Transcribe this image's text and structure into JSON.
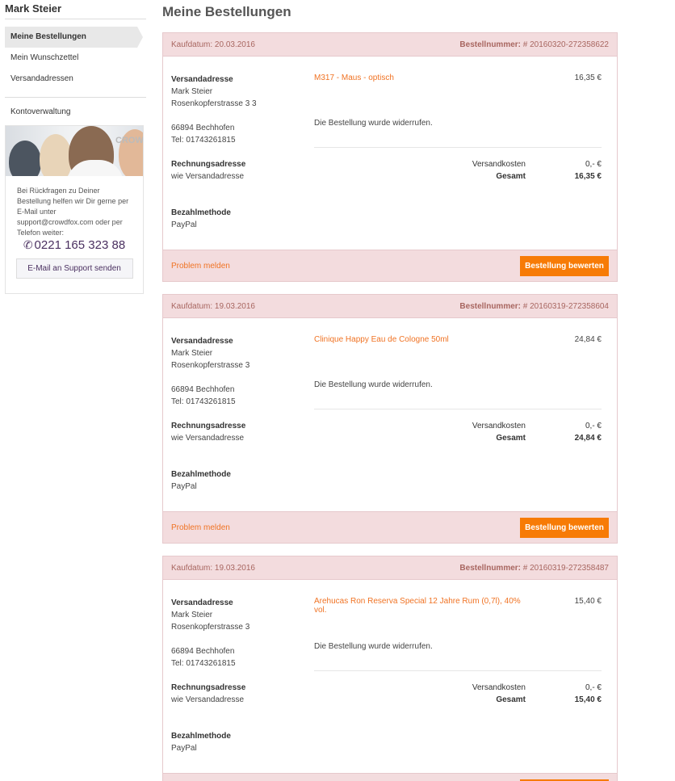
{
  "user": {
    "name": "Mark Steier"
  },
  "nav": {
    "items": [
      "Meine Bestellungen",
      "Mein Wunschzettel",
      "Versandadressen"
    ],
    "account": "Kontoverwaltung"
  },
  "support": {
    "image_logo": "CROWD",
    "text": "Bei Rückfragen zu Deiner Bestellung helfen wir Dir gerne per E-Mail unter support@crowdfox.com oder per Telefon weiter:",
    "phone": "0221 165 323 88",
    "button": "E-Mail an Support senden",
    "phone_icon": "phone-icon"
  },
  "page": {
    "title": "Meine Bestellungen"
  },
  "labels": {
    "purchase_date_prefix": "Kaufdatum:",
    "order_number_label": "Bestellnummer:",
    "shipping_address": "Versandadresse",
    "billing_address": "Rechnungsadresse",
    "payment_method": "Bezahlmethode",
    "shipping_cost": "Versandkosten",
    "total": "Gesamt",
    "report_problem": "Problem melden",
    "rate_order": "Bestellung bewerten"
  },
  "colors": {
    "accent": "#f77b06",
    "link": "#f07324",
    "header_bg": "#f3dcde"
  },
  "orders": [
    {
      "date": "Kaufdatum: 20.03.2016",
      "number": "# 20160320-272358622",
      "ship_name": "Mark Steier",
      "ship_street": "Rosenkopferstrasse 3 3",
      "ship_city": "66894 Bechhofen",
      "ship_tel": "Tel: 01743261815",
      "billing": "wie Versandadresse",
      "payment": "PayPal",
      "product": "M317 - Maus - optisch",
      "price": "16,35 €",
      "status": "Die Bestellung wurde widerrufen.",
      "shipping": "0,- €",
      "total": "16,35 €"
    },
    {
      "date": "Kaufdatum: 19.03.2016",
      "number": "# 20160319-272358604",
      "ship_name": "Mark Steier",
      "ship_street": "Rosenkopferstrasse 3",
      "ship_city": "66894 Bechhofen",
      "ship_tel": "Tel: 01743261815",
      "billing": "wie Versandadresse",
      "payment": "PayPal",
      "product": "Clinique Happy Eau de Cologne 50ml",
      "price": "24,84 €",
      "status": "Die Bestellung wurde widerrufen.",
      "shipping": "0,- €",
      "total": "24,84 €"
    },
    {
      "date": "Kaufdatum: 19.03.2016",
      "number": "# 20160319-272358487",
      "ship_name": "Mark Steier",
      "ship_street": "Rosenkopferstrasse 3",
      "ship_city": "66894 Bechhofen",
      "ship_tel": "Tel: 01743261815",
      "billing": "wie Versandadresse",
      "payment": "PayPal",
      "product": "Arehucas Ron Reserva Special 12 Jahre Rum (0,7l), 40% vol.",
      "price": "15,40 €",
      "status": "Die Bestellung wurde widerrufen.",
      "shipping": "0,- €",
      "total": "15,40 €"
    }
  ]
}
